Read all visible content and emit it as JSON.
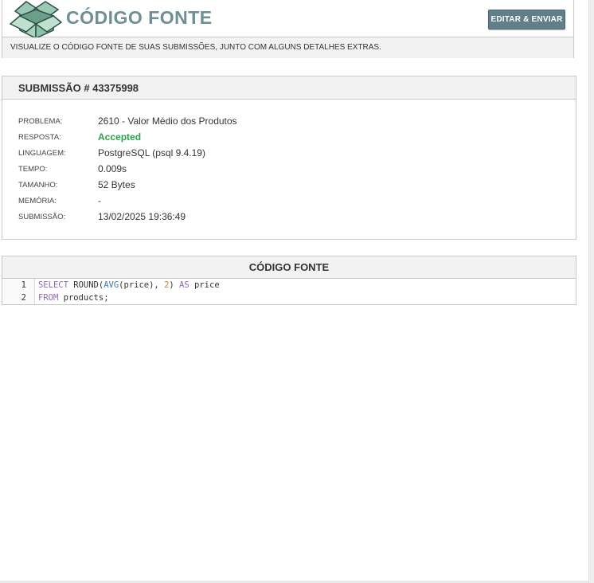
{
  "header": {
    "title": "CÓDIGO FONTE",
    "edit_button_label": "EDITAR & ENVIAR",
    "description": "VISUALIZE O CÓDIGO FONTE DE SUAS SUBMISSÕES, JUNTO COM ALGUNS DETALHES EXTRAS.",
    "logo_icon": "open-box-icon"
  },
  "submission": {
    "heading": "SUBMISSÃO # 43375998",
    "fields": [
      {
        "label": "PROBLEMA:",
        "value": "2610 - Valor Médio dos Produtos"
      },
      {
        "label": "RESPOSTA:",
        "value": "Accepted"
      },
      {
        "label": "LINGUAGEM:",
        "value": "PostgreSQL (psql 9.4.19)"
      },
      {
        "label": "TEMPO:",
        "value": "0.009s"
      },
      {
        "label": "TAMANHO:",
        "value": "52 Bytes"
      },
      {
        "label": "MEMÓRIA:",
        "value": "-"
      },
      {
        "label": "SUBMISSÃO:",
        "value": "13/02/2025 19:36:49"
      }
    ]
  },
  "code": {
    "heading": "CÓDIGO FONTE",
    "lines": [
      {
        "number": "1",
        "tokens": [
          {
            "text": "SELECT",
            "kind": "kw"
          },
          {
            "text": " ROUND(",
            "kind": "fn"
          },
          {
            "text": "AVG",
            "kind": "fn2"
          },
          {
            "text": "(price), ",
            "kind": "fn"
          },
          {
            "text": "2",
            "kind": "num"
          },
          {
            "text": ") ",
            "kind": "fn"
          },
          {
            "text": "AS",
            "kind": "kw"
          },
          {
            "text": " price",
            "kind": "fn"
          }
        ]
      },
      {
        "number": "2",
        "tokens": [
          {
            "text": "FROM",
            "kind": "kw"
          },
          {
            "text": " products;",
            "kind": "fn"
          }
        ]
      }
    ]
  },
  "colors": {
    "accent": "#607f88",
    "title": "#6f8e96",
    "accepted": "#2aa04a",
    "keyword": "#8a6ab0",
    "number": "#d08a2a",
    "function": "#3a7fb8"
  }
}
